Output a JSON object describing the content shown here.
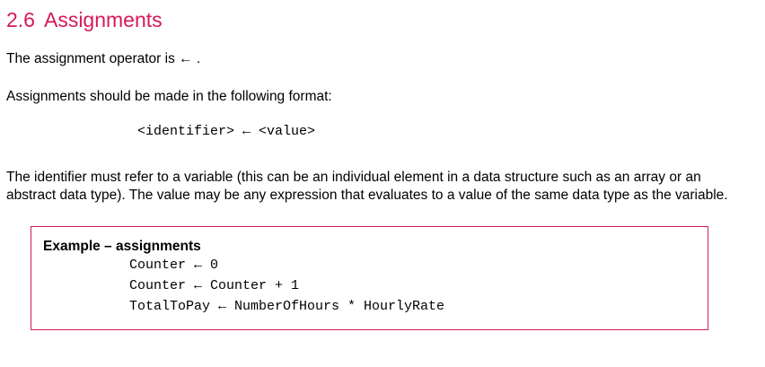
{
  "section": {
    "number": "2.6",
    "title": "Assignments"
  },
  "intro": "The assignment operator is ← .",
  "format_intro": "Assignments should be made in the following format:",
  "format_code": "<identifier> ← <value>",
  "description": "The identifier must refer to a variable (this can be an individual element in a data structure such as an array or an abstract data type). The value may be any expression that evaluates to a value of the same data type as the variable.",
  "example": {
    "title": "Example – assignments",
    "lines": [
      "Counter ← 0",
      "Counter ← Counter + 1",
      "TotalToPay ← NumberOfHours * HourlyRate"
    ]
  }
}
